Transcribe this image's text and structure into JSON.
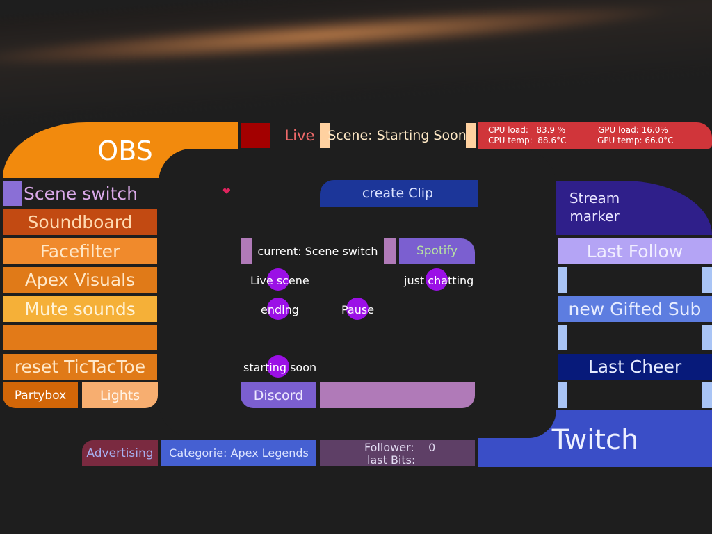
{
  "colors": {
    "background": "#1e1e1e",
    "obs_orange": "#f28a0d",
    "twitch_blue": "#3a4ec7",
    "live_red": "#ef6a6a",
    "purple_dot": "#9b10e6"
  },
  "header": {
    "obs_title": "OBS",
    "live_label": "Live",
    "scene_label": "Scene: Starting Soon",
    "stats": {
      "cpu_load": "CPU load:   83.9 %",
      "cpu_temp": "CPU temp:  88.6°C",
      "gpu_load": "GPU load: 16.0%",
      "gpu_temp": "GPU temp: 66.0°C"
    }
  },
  "left_menu": {
    "scene_switch": "Scene switch",
    "soundboard": "Soundboard",
    "facefilter": "Facefilter",
    "apex_visuals": "Apex Visuals",
    "mute_sounds": "Mute sounds",
    "empty": "",
    "reset_tictactoe": "reset TicTacToe",
    "partybox": "Partybox",
    "lights": "Lights"
  },
  "center": {
    "heart_icon": "heart-icon",
    "create_clip": "create Clip",
    "current_scene": "current: Scene switch",
    "spotify": "Spotify",
    "scenes": {
      "live_scene": "Live scene",
      "just_chatting": "just chatting",
      "ending": "ending",
      "pause": "Pause",
      "starting_soon": "starting soon"
    },
    "discord": "Discord"
  },
  "right_menu": {
    "stream_marker_line1": "Stream",
    "stream_marker_line2": "marker",
    "last_follow": "Last Follow",
    "new_gifted_sub": "new Gifted Sub",
    "last_cheer": "Last Cheer",
    "twitch_title": "Twitch"
  },
  "footer": {
    "advertising": "Advertising",
    "category": "Categorie: Apex Legends",
    "follower": "Follower:    0",
    "last_bits": "last Bits:"
  }
}
